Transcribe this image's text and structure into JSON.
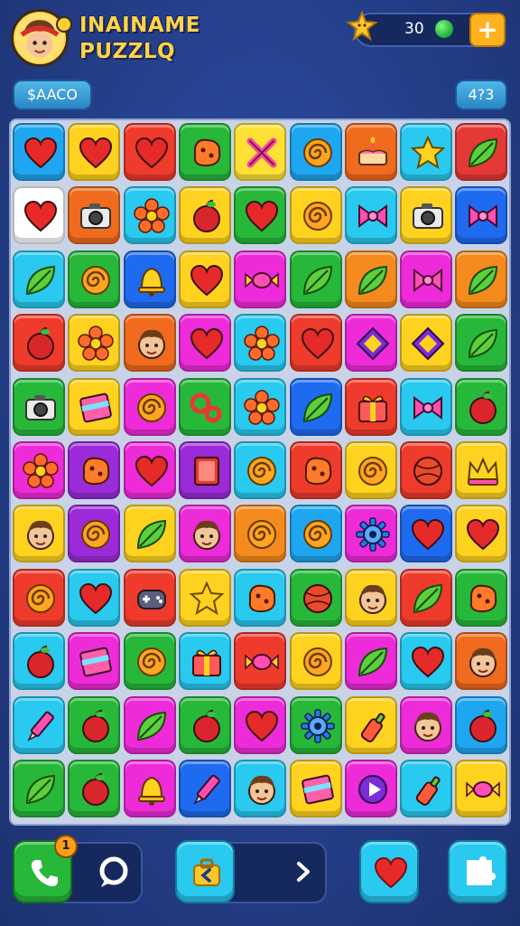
{
  "header": {
    "title_line1": "INAINAME",
    "title_line2": "PUZZLQ",
    "coin_value": "30",
    "plus_label": "+",
    "left_chip": "$AACO",
    "right_chip": "4?3"
  },
  "board": {
    "rows": 11,
    "cols": 9,
    "tiles": [
      [
        "heart",
        "#1ea7f0"
      ],
      [
        "heart",
        "#ffd21f"
      ],
      [
        "heart",
        "#ee3b2b"
      ],
      [
        "blob",
        "#27b83a"
      ],
      [
        "x",
        "#ffe135"
      ],
      [
        "swirl",
        "#1ea7f0"
      ],
      [
        "cake",
        "#f06b1e"
      ],
      [
        "star",
        "#29c9f0"
      ],
      [
        "leaf",
        "#e53935"
      ],
      [
        "heart",
        "#ffffff"
      ],
      [
        "camera",
        "#f06b1e"
      ],
      [
        "flower",
        "#29c9f0"
      ],
      [
        "apple",
        "#ffd21f"
      ],
      [
        "heart",
        "#27b83a"
      ],
      [
        "swirl",
        "#ffd21f"
      ],
      [
        "bow",
        "#29c9f0"
      ],
      [
        "camera",
        "#ffd21f"
      ],
      [
        "bow",
        "#1e6bf0"
      ],
      [
        "leaf",
        "#29c9f0"
      ],
      [
        "swirl",
        "#27b83a"
      ],
      [
        "bell",
        "#1e6bf0"
      ],
      [
        "heart",
        "#ffd21f"
      ],
      [
        "candy",
        "#ee2bd8"
      ],
      [
        "leaf",
        "#27b83a"
      ],
      [
        "leaf",
        "#f58a1e"
      ],
      [
        "bow",
        "#ee2bd8"
      ],
      [
        "leaf",
        "#f58a1e"
      ],
      [
        "apple",
        "#ee3b2b"
      ],
      [
        "flower",
        "#ffd21f"
      ],
      [
        "face",
        "#f06b1e"
      ],
      [
        "heart",
        "#ee2bd8"
      ],
      [
        "flower",
        "#29c9f0"
      ],
      [
        "heart",
        "#ee3b2b"
      ],
      [
        "diamond",
        "#ee2bd8"
      ],
      [
        "diamond",
        "#ffd21f"
      ],
      [
        "leaf",
        "#27b83a"
      ],
      [
        "camera",
        "#27b83a"
      ],
      [
        "flag",
        "#ffd21f"
      ],
      [
        "swirl",
        "#ee2bd8"
      ],
      [
        "knot",
        "#27b83a"
      ],
      [
        "flower",
        "#29c9f0"
      ],
      [
        "leaf",
        "#1e6bf0"
      ],
      [
        "gift",
        "#ee3b2b"
      ],
      [
        "bow",
        "#29c9f0"
      ],
      [
        "apple",
        "#27b83a"
      ],
      [
        "flower",
        "#ee2bd8"
      ],
      [
        "blob",
        "#9b2bd8"
      ],
      [
        "heart",
        "#ee2bd8"
      ],
      [
        "book",
        "#9b2bd8"
      ],
      [
        "swirl",
        "#29c9f0"
      ],
      [
        "blob",
        "#ee3b2b"
      ],
      [
        "swirl",
        "#ffd21f"
      ],
      [
        "ball",
        "#ee3b2b"
      ],
      [
        "crown",
        "#ffd21f"
      ],
      [
        "face",
        "#ffd21f"
      ],
      [
        "swirl",
        "#9b2bd8"
      ],
      [
        "leaf",
        "#ffd21f"
      ],
      [
        "face",
        "#ee2bd8"
      ],
      [
        "swirl",
        "#f58a1e"
      ],
      [
        "swirl",
        "#1ea7f0"
      ],
      [
        "gear",
        "#ee2bd8"
      ],
      [
        "heart",
        "#1e6bf0"
      ],
      [
        "heart",
        "#ffd21f"
      ],
      [
        "swirl",
        "#ee3b2b"
      ],
      [
        "heart",
        "#29c9f0"
      ],
      [
        "game",
        "#ee3b2b"
      ],
      [
        "star",
        "#ffd21f"
      ],
      [
        "blob",
        "#29c9f0"
      ],
      [
        "ball",
        "#27b83a"
      ],
      [
        "face",
        "#ffd21f"
      ],
      [
        "leaf",
        "#ee3b2b"
      ],
      [
        "blob",
        "#27b83a"
      ],
      [
        "apple",
        "#29c9f0"
      ],
      [
        "flag",
        "#ee2bd8"
      ],
      [
        "swirl",
        "#27b83a"
      ],
      [
        "gift",
        "#29c9f0"
      ],
      [
        "candy",
        "#ee3b2b"
      ],
      [
        "swirl",
        "#ffd21f"
      ],
      [
        "leaf",
        "#ee2bd8"
      ],
      [
        "heart",
        "#29c9f0"
      ],
      [
        "face",
        "#f06b1e"
      ],
      [
        "pencil",
        "#29c9f0"
      ],
      [
        "apple",
        "#27b83a"
      ],
      [
        "leaf",
        "#ee2bd8"
      ],
      [
        "apple",
        "#27b83a"
      ],
      [
        "heart",
        "#ee2bd8"
      ],
      [
        "gear",
        "#27b83a"
      ],
      [
        "bottle",
        "#ffd21f"
      ],
      [
        "face",
        "#ee2bd8"
      ],
      [
        "apple",
        "#1ea7f0"
      ],
      [
        "leaf",
        "#27b83a"
      ],
      [
        "apple",
        "#27b83a"
      ],
      [
        "bell",
        "#ee2bd8"
      ],
      [
        "pencil",
        "#1e6bf0"
      ],
      [
        "face",
        "#29c9f0"
      ],
      [
        "flag",
        "#ffd21f"
      ],
      [
        "play",
        "#ee2bd8"
      ],
      [
        "bottle",
        "#29c9f0"
      ],
      [
        "candy",
        "#ffd21f"
      ]
    ]
  },
  "bottom": {
    "notification_count": "1"
  }
}
